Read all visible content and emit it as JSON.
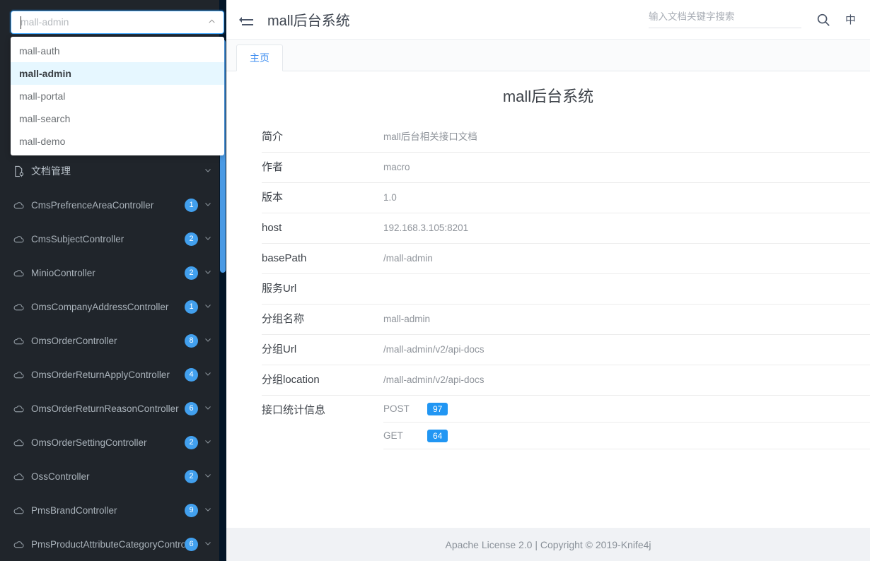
{
  "sidebar": {
    "service_select": {
      "value": "",
      "placeholder": "mall-admin",
      "arrow_icon": "chevron-up-icon",
      "open": true,
      "options": [
        {
          "label": "mall-auth",
          "selected": false
        },
        {
          "label": "mall-admin",
          "selected": true
        },
        {
          "label": "mall-portal",
          "selected": false
        },
        {
          "label": "mall-search",
          "selected": false
        },
        {
          "label": "mall-demo",
          "selected": false
        }
      ]
    },
    "items": [
      {
        "label": "文档管理",
        "icon": "file-settings-icon",
        "count": null,
        "chevron": "chevron-down-icon",
        "group": true
      },
      {
        "label": "CmsPrefrenceAreaController",
        "icon": "cloud-icon",
        "count": "1",
        "chevron": "chevron-down-icon",
        "group": false
      },
      {
        "label": "CmsSubjectController",
        "icon": "cloud-icon",
        "count": "2",
        "chevron": "chevron-down-icon",
        "group": false
      },
      {
        "label": "MinioController",
        "icon": "cloud-icon",
        "count": "2",
        "chevron": "chevron-down-icon",
        "group": false
      },
      {
        "label": "OmsCompanyAddressController",
        "icon": "cloud-icon",
        "count": "1",
        "chevron": "chevron-down-icon",
        "group": false
      },
      {
        "label": "OmsOrderController",
        "icon": "cloud-icon",
        "count": "8",
        "chevron": "chevron-down-icon",
        "group": false
      },
      {
        "label": "OmsOrderReturnApplyController",
        "icon": "cloud-icon",
        "count": "4",
        "chevron": "chevron-down-icon",
        "group": false
      },
      {
        "label": "OmsOrderReturnReasonController",
        "icon": "cloud-icon",
        "count": "6",
        "chevron": "chevron-down-icon",
        "group": false
      },
      {
        "label": "OmsOrderSettingController",
        "icon": "cloud-icon",
        "count": "2",
        "chevron": "chevron-down-icon",
        "group": false
      },
      {
        "label": "OssController",
        "icon": "cloud-icon",
        "count": "2",
        "chevron": "chevron-down-icon",
        "group": false
      },
      {
        "label": "PmsBrandController",
        "icon": "cloud-icon",
        "count": "9",
        "chevron": "chevron-down-icon",
        "group": false
      },
      {
        "label": "PmsProductAttributeCategoryController",
        "icon": "cloud-icon",
        "count": "6",
        "chevron": "chevron-down-icon",
        "group": false
      }
    ]
  },
  "header": {
    "fold_icon": "menu-fold-icon",
    "title": "mall后台系统",
    "search_placeholder": "输入文档关键字搜索",
    "search_value": "",
    "search_icon": "search-icon",
    "lang_label": "中"
  },
  "tabs": [
    {
      "label": "主页",
      "active": true
    }
  ],
  "main": {
    "doc_title": "mall后台系统",
    "rows": [
      {
        "label": "简介",
        "value": "mall后台相关接口文档"
      },
      {
        "label": "作者",
        "value": "macro"
      },
      {
        "label": "版本",
        "value": "1.0"
      },
      {
        "label": "host",
        "value": "192.168.3.105:8201"
      },
      {
        "label": "basePath",
        "value": "/mall-admin"
      },
      {
        "label": "服务Url",
        "value": ""
      },
      {
        "label": "分组名称",
        "value": "mall-admin"
      },
      {
        "label": "分组Url",
        "value": "/mall-admin/v2/api-docs"
      },
      {
        "label": "分组location",
        "value": "/mall-admin/v2/api-docs"
      }
    ],
    "stats_label": "接口统计信息",
    "stats": [
      {
        "method": "POST",
        "count": "97"
      },
      {
        "method": "GET",
        "count": "64"
      }
    ]
  },
  "footer": {
    "text": "Apache License 2.0 | Copyright © 2019-Knife4j"
  },
  "colors": {
    "sidebar_bg": "#20252b",
    "sidebar_edge": "#031527",
    "accent_blue": "#2196f3",
    "badge_blue": "#42a0ee",
    "tab_active": "#3c8cf0",
    "dropdown_selected_bg": "#e6f7ff"
  }
}
